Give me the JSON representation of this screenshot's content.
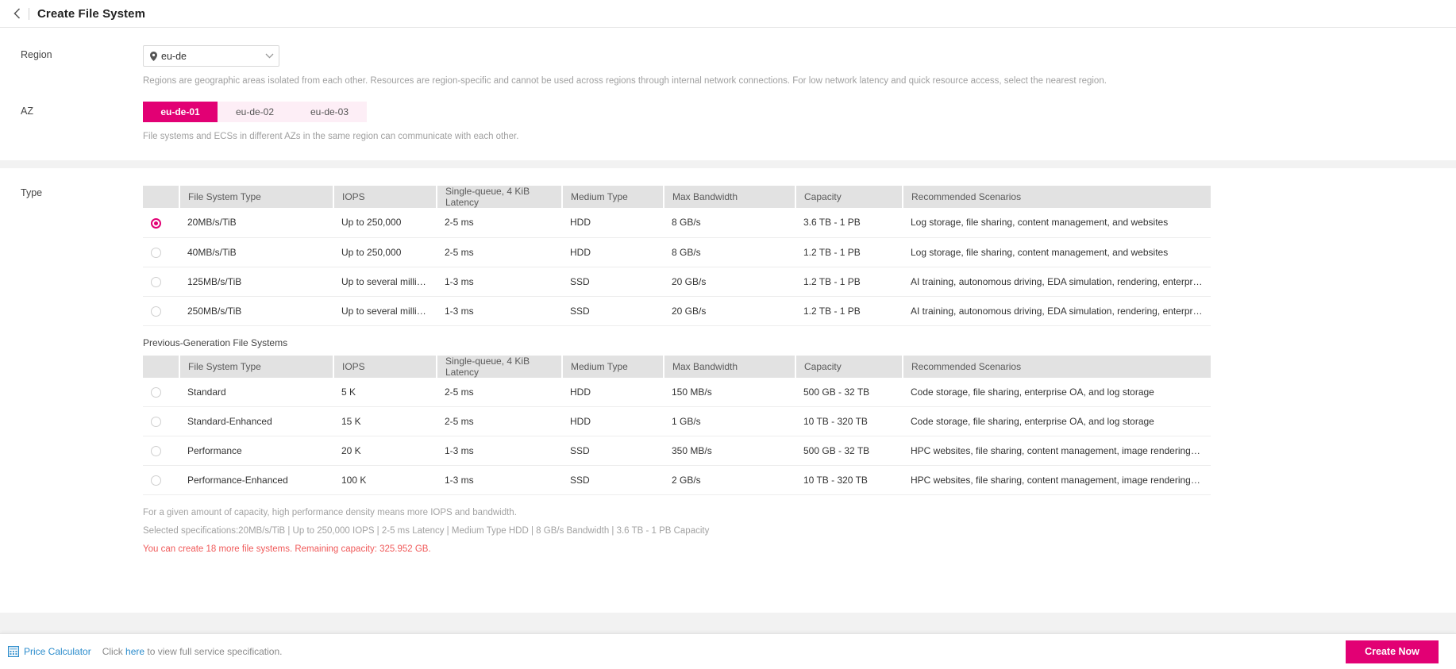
{
  "header": {
    "back_icon": "chevron-left-icon",
    "title": "Create File System"
  },
  "form": {
    "region": {
      "label": "Region",
      "icon": "location-pin-icon",
      "value": "eu-de",
      "chevron": "chevron-down-icon",
      "hint": "Regions are geographic areas isolated from each other. Resources are region-specific and cannot be used across regions through internal network connections. For low network latency and quick resource access, select the nearest region."
    },
    "az": {
      "label": "AZ",
      "options": [
        "eu-de-01",
        "eu-de-02",
        "eu-de-03"
      ],
      "selected": "eu-de-01",
      "hint": "File systems and ECSs in different AZs in the same region can communicate with each other."
    },
    "type": {
      "label": "Type",
      "columns": [
        "File System Type",
        "IOPS",
        "Single-queue, 4 KiB Latency",
        "Medium Type",
        "Max Bandwidth",
        "Capacity",
        "Recommended Scenarios"
      ],
      "rows": [
        {
          "selected": true,
          "fs_type": "20MB/s/TiB",
          "iops": "Up to 250,000",
          "latency": "2-5 ms",
          "medium": "HDD",
          "bandwidth": "8 GB/s",
          "capacity": "3.6 TB - 1 PB",
          "scenarios": "Log storage, file sharing, content management, and websites"
        },
        {
          "selected": false,
          "fs_type": "40MB/s/TiB",
          "iops": "Up to 250,000",
          "latency": "2-5 ms",
          "medium": "HDD",
          "bandwidth": "8 GB/s",
          "capacity": "1.2 TB - 1 PB",
          "scenarios": "Log storage, file sharing, content management, and websites"
        },
        {
          "selected": false,
          "fs_type": "125MB/s/TiB",
          "iops": "Up to several millions",
          "latency": "1-3 ms",
          "medium": "SSD",
          "bandwidth": "20 GB/s",
          "capacity": "1.2 TB - 1 PB",
          "scenarios": "AI training, autonomous driving, EDA simulation, rendering, enterprise NAS, and…"
        },
        {
          "selected": false,
          "fs_type": "250MB/s/TiB",
          "iops": "Up to several millions",
          "latency": "1-3 ms",
          "medium": "SSD",
          "bandwidth": "20 GB/s",
          "capacity": "1.2 TB - 1 PB",
          "scenarios": "AI training, autonomous driving, EDA simulation, rendering, enterprise NAS, and…"
        }
      ],
      "previous_generation": {
        "title": "Previous-Generation File Systems",
        "columns": [
          "File System Type",
          "IOPS",
          "Single-queue, 4 KiB Latency",
          "Medium Type",
          "Max Bandwidth",
          "Capacity",
          "Recommended Scenarios"
        ],
        "rows": [
          {
            "selected": false,
            "fs_type": "Standard",
            "iops": "5 K",
            "latency": "2-5 ms",
            "medium": "HDD",
            "bandwidth": "150 MB/s",
            "capacity": "500 GB - 32 TB",
            "scenarios": "Code storage, file sharing, enterprise OA, and log storage"
          },
          {
            "selected": false,
            "fs_type": "Standard-Enhanced",
            "iops": "15 K",
            "latency": "2-5 ms",
            "medium": "HDD",
            "bandwidth": "1 GB/s",
            "capacity": "10 TB - 320 TB",
            "scenarios": "Code storage, file sharing, enterprise OA, and log storage"
          },
          {
            "selected": false,
            "fs_type": "Performance",
            "iops": "20 K",
            "latency": "1-3 ms",
            "medium": "SSD",
            "bandwidth": "350 MB/s",
            "capacity": "500 GB - 32 TB",
            "scenarios": "HPC websites, file sharing, content management, image rendering, AI training, a…"
          },
          {
            "selected": false,
            "fs_type": "Performance-Enhanced",
            "iops": "100 K",
            "latency": "1-3 ms",
            "medium": "SSD",
            "bandwidth": "2 GB/s",
            "capacity": "10 TB - 320 TB",
            "scenarios": "HPC websites, file sharing, content management, image rendering, AI training, a…"
          }
        ]
      },
      "notes": {
        "density": "For a given amount of capacity, high performance density means more IOPS and bandwidth.",
        "selected_spec": "Selected specifications:20MB/s/TiB | Up to 250,000 IOPS | 2-5 ms Latency | Medium Type HDD | 8 GB/s Bandwidth | 3.6 TB - 1 PB Capacity",
        "quota_warning": "You can create 18 more file systems. Remaining capacity: 325.952 GB."
      }
    }
  },
  "footer": {
    "calculator_icon": "calculator-icon",
    "calculator_label": "Price Calculator",
    "spec_prefix": "Click ",
    "spec_link": "here",
    "spec_suffix": " to view full service specification.",
    "create_button": "Create Now"
  },
  "colors": {
    "accent": "#e20074",
    "link": "#2b8ccc",
    "warning": "#f05a5a"
  }
}
